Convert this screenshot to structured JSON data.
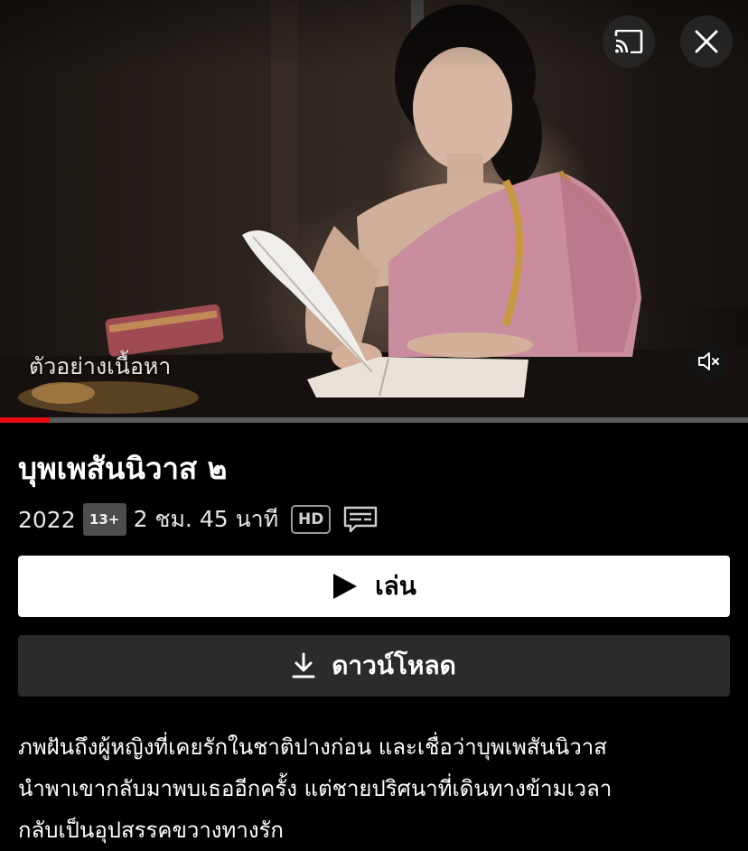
{
  "player": {
    "caption": "ตัวอย่างเนื้อหา",
    "progress_fraction": 0.067,
    "accent_color": "#e50914",
    "controls": {
      "cast_icon": "cast-icon",
      "close_icon": "close-icon",
      "mute_icon": "volume-muted-icon"
    }
  },
  "title": {
    "text": "บุพเพสันนิวาส ๒"
  },
  "meta": {
    "year": "2022",
    "rating": "13+",
    "duration": "2 ชม. 45 นาที",
    "quality": "HD",
    "subtitles_icon": "subtitles-icon"
  },
  "actions": {
    "play_label": "เล่น",
    "play_icon": "play-icon",
    "download_label": "ดาวน์โหลด",
    "download_icon": "download-icon"
  },
  "description": {
    "lines": [
      "ภพฝันถึงผู้หญิงที่เคยรักในชาติปางก่อน และเชื่อว่าบุพเพสันนิวาส",
      "นำพาเขากลับมาพบเธออีกครั้ง แต่ชายปริศนาที่เดินทางข้ามเวลา",
      "กลับเป็นอุปสรรคขวางทางรัก"
    ]
  }
}
